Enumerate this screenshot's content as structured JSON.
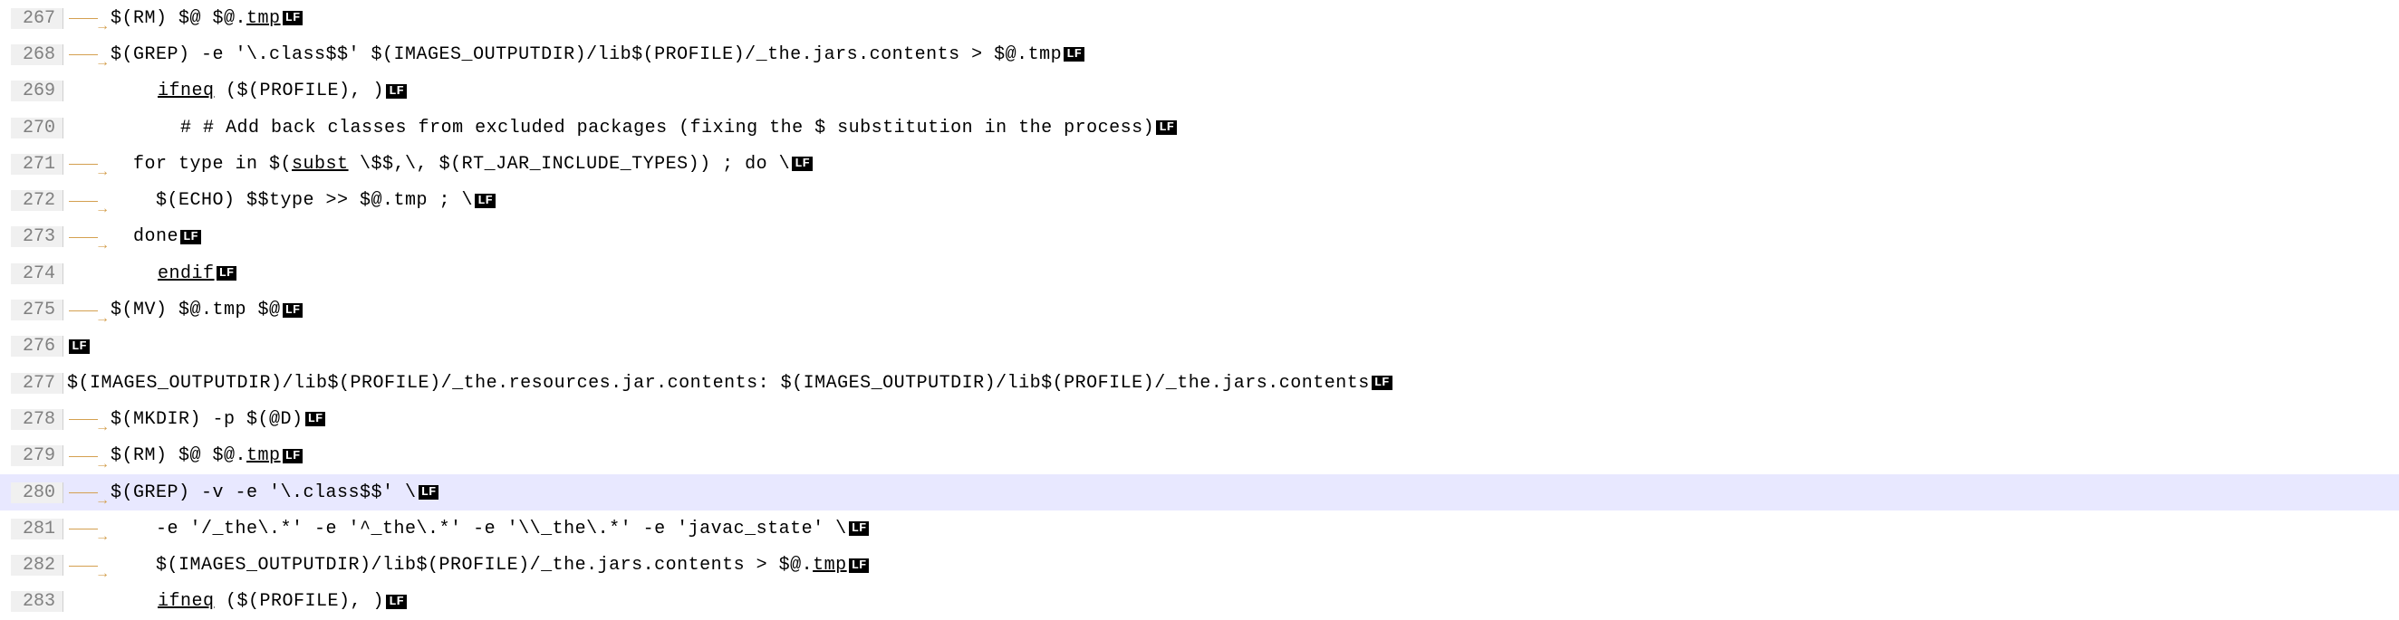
{
  "lines": [
    {
      "num": 267,
      "indents": 1,
      "highlighted": false,
      "segments": [
        {
          "t": "$(RM) $@ $@."
        },
        {
          "t": "tmp",
          "u": true
        }
      ],
      "lf": true
    },
    {
      "num": 268,
      "indents": 1,
      "highlighted": false,
      "segments": [
        {
          "t": "$(GREP) -e '\\.class$$' $(IMAGES_OUTPUTDIR)/lib$(PROFILE)/_the.jars.contents > $@.tmp"
        }
      ],
      "lf": true
    },
    {
      "num": 269,
      "indents": 0,
      "highlighted": false,
      "segments": [
        {
          "t": "        "
        },
        {
          "t": "ifneq",
          "u": true
        },
        {
          "t": " ($(PROFILE), )"
        }
      ],
      "lf": true
    },
    {
      "num": 270,
      "indents": 0,
      "highlighted": false,
      "segments": [
        {
          "t": "          # # Add back classes from excluded packages (fixing the $ substitution in the process)"
        }
      ],
      "lf": true
    },
    {
      "num": 271,
      "indents": 1,
      "highlighted": false,
      "segments": [
        {
          "t": "  for type in $("
        },
        {
          "t": "subst",
          "u": true
        },
        {
          "t": " \\$$,\\, $(RT_JAR_INCLUDE_TYPES)) ; do \\"
        }
      ],
      "lf": true
    },
    {
      "num": 272,
      "indents": 1,
      "highlighted": false,
      "segments": [
        {
          "t": "    $(ECHO) $$type >> $@.tmp ; \\"
        }
      ],
      "lf": true
    },
    {
      "num": 273,
      "indents": 1,
      "highlighted": false,
      "segments": [
        {
          "t": "  done"
        }
      ],
      "lf": true
    },
    {
      "num": 274,
      "indents": 0,
      "highlighted": false,
      "segments": [
        {
          "t": "        "
        },
        {
          "t": "endif",
          "u": true
        }
      ],
      "lf": true
    },
    {
      "num": 275,
      "indents": 1,
      "highlighted": false,
      "segments": [
        {
          "t": "$(MV) $@.tmp $@"
        }
      ],
      "lf": true
    },
    {
      "num": 276,
      "indents": 0,
      "highlighted": false,
      "segments": [],
      "lf": true
    },
    {
      "num": 277,
      "indents": 0,
      "highlighted": false,
      "segments": [
        {
          "t": "$(IMAGES_OUTPUTDIR)/lib$(PROFILE)/_the.resources.jar.contents: $(IMAGES_OUTPUTDIR)/lib$(PROFILE)/_the.jars.contents"
        }
      ],
      "lf": true
    },
    {
      "num": 278,
      "indents": 1,
      "highlighted": false,
      "segments": [
        {
          "t": "$(MKDIR) -p $(@D)"
        }
      ],
      "lf": true
    },
    {
      "num": 279,
      "indents": 1,
      "highlighted": false,
      "segments": [
        {
          "t": "$(RM) $@ $@."
        },
        {
          "t": "tmp",
          "u": true
        }
      ],
      "lf": true
    },
    {
      "num": 280,
      "indents": 1,
      "highlighted": true,
      "segments": [
        {
          "t": "$(GREP) -v -e '\\.class$$' \\"
        }
      ],
      "lf": true
    },
    {
      "num": 281,
      "indents": 1,
      "highlighted": false,
      "segments": [
        {
          "t": "    -e '/_the\\.*' -e '^_the\\.*' -e '\\\\_the\\.*' -e 'javac_state' \\"
        }
      ],
      "lf": true
    },
    {
      "num": 282,
      "indents": 1,
      "highlighted": false,
      "segments": [
        {
          "t": "    $(IMAGES_OUTPUTDIR)/lib$(PROFILE)/_the.jars.contents > $@."
        },
        {
          "t": "tmp",
          "u": true
        }
      ],
      "lf": true
    },
    {
      "num": 283,
      "indents": 0,
      "highlighted": false,
      "segments": [
        {
          "t": "        "
        },
        {
          "t": "ifneq",
          "u": true
        },
        {
          "t": " ($(PROFILE), )"
        }
      ],
      "lf": true
    }
  ],
  "lf_badge": "LF"
}
